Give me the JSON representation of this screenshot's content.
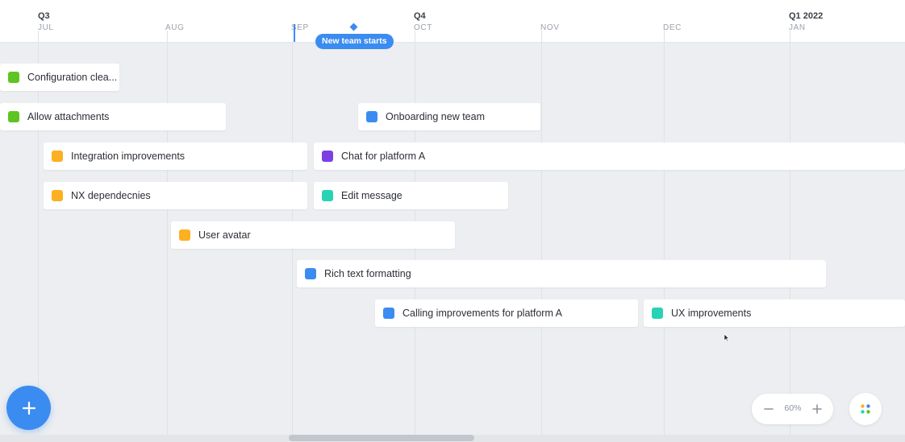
{
  "timeline": {
    "quarters": [
      {
        "label": "Q3"
      },
      {
        "label": "Q4"
      },
      {
        "label": "Q1 2022"
      }
    ],
    "months": [
      {
        "label": "JUL"
      },
      {
        "label": "AUG"
      },
      {
        "label": "SEP"
      },
      {
        "label": "OCT"
      },
      {
        "label": "NOV"
      },
      {
        "label": "DEC"
      },
      {
        "label": "JAN"
      }
    ],
    "milestone": {
      "label": "New team starts"
    }
  },
  "cards": [
    {
      "label": "Configuration clea...",
      "color": "#5ec422"
    },
    {
      "label": "Allow attachments",
      "color": "#5ec422"
    },
    {
      "label": "Onboarding new team",
      "color": "#3b8cf0"
    },
    {
      "label": "Integration improvements",
      "color": "#fdb022"
    },
    {
      "label": "Chat for platform A",
      "color": "#7c3fe4"
    },
    {
      "label": "NX dependecnies",
      "color": "#fdb022"
    },
    {
      "label": "Edit message",
      "color": "#27d3b4"
    },
    {
      "label": "User avatar",
      "color": "#fdb022"
    },
    {
      "label": "Rich text formatting",
      "color": "#3b8cf0"
    },
    {
      "label": "Calling improvements for platform A",
      "color": "#3b8cf0"
    },
    {
      "label": "UX improvements",
      "color": "#27d3b4"
    }
  ],
  "zoom": {
    "value": "60%",
    "minus_icon": "minus-icon",
    "plus_icon": "plus-icon"
  },
  "fab": {
    "icon": "plus-icon"
  },
  "apps_button": {
    "icon": "apps-dots-icon"
  },
  "colors": {
    "accent": "#3b8cf0",
    "background": "#eceef1"
  }
}
